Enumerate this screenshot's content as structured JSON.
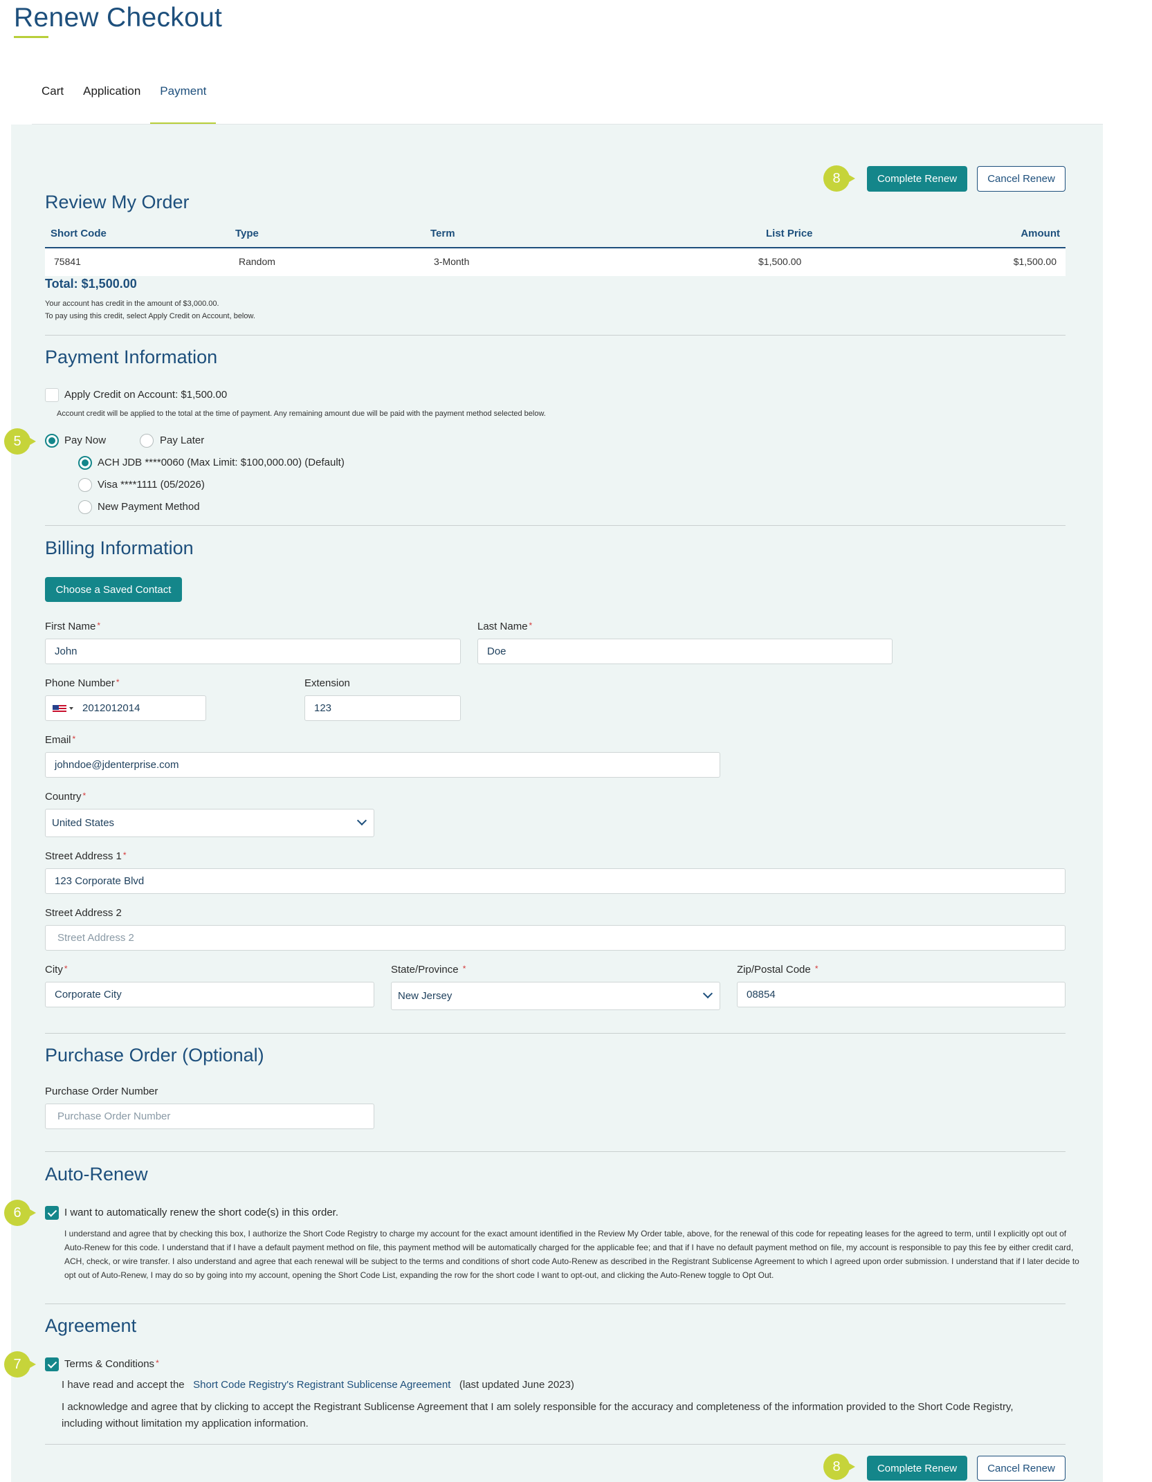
{
  "page": {
    "title": "Renew Checkout"
  },
  "tabs": [
    {
      "label": "Cart"
    },
    {
      "label": "Application"
    },
    {
      "label": "Payment"
    }
  ],
  "actions": {
    "complete_label": "Complete Renew",
    "cancel_label": "Cancel Renew"
  },
  "badges": {
    "top_complete": "8",
    "pay_now": "5",
    "auto_renew": "6",
    "terms": "7",
    "bottom_complete": "8"
  },
  "order": {
    "heading": "Review My Order",
    "columns": [
      "Short Code",
      "Type",
      "Term",
      "List Price",
      "Amount"
    ],
    "rows": [
      {
        "short_code": "75841",
        "type": "Random",
        "term": "3-Month",
        "list_price": "$1,500.00",
        "amount": "$1,500.00"
      }
    ],
    "total": "Total: $1,500.00",
    "credit_note_1": "Your account has credit in the amount of $3,000.00.",
    "credit_note_2": "To pay using this credit, select Apply Credit on Account, below."
  },
  "payment": {
    "heading": "Payment Information",
    "apply_credit_label": "Apply Credit on Account: $1,500.00",
    "apply_credit_note": "Account credit will be applied to the total at the time of payment. Any remaining amount due will be paid with the payment method selected below.",
    "pay_now": "Pay Now",
    "pay_later": "Pay Later",
    "methods": [
      {
        "label": "ACH JDB ****0060 (Max Limit: $100,000.00) (Default)"
      },
      {
        "label": "Visa ****1111 (05/2026)"
      },
      {
        "label": "New Payment Method"
      }
    ]
  },
  "billing": {
    "heading": "Billing Information",
    "saved_contact_button": "Choose a Saved Contact",
    "first_name": {
      "label": "First Name",
      "value": "John"
    },
    "last_name": {
      "label": "Last Name",
      "value": "Doe"
    },
    "phone": {
      "label": "Phone Number",
      "value": "2012012014"
    },
    "extension": {
      "label": "Extension",
      "value": "123"
    },
    "email": {
      "label": "Email",
      "value": "johndoe@jdenterprise.com"
    },
    "country": {
      "label": "Country",
      "value": "United States"
    },
    "street1": {
      "label": "Street Address 1",
      "value": "123 Corporate Blvd"
    },
    "street2": {
      "label": "Street Address 2",
      "placeholder": "Street Address 2"
    },
    "city": {
      "label": "City",
      "value": "Corporate City"
    },
    "state": {
      "label": "State/Province",
      "value": "New Jersey"
    },
    "zip": {
      "label": "Zip/Postal Code",
      "value": "08854"
    },
    "required_mark": "*"
  },
  "purchase_order": {
    "heading": "Purchase Order (Optional)",
    "label": "Purchase Order Number",
    "placeholder": "Purchase Order Number"
  },
  "auto_renew": {
    "heading": "Auto-Renew",
    "checkbox_label": "I want to automatically renew the short code(s) in this order.",
    "disclaimer": "I understand and agree that by checking this box, I authorize the Short Code Registry to charge my account for the exact amount identified in the Review My Order table, above, for the renewal of this code for repeating leases for the agreed to term, until I explicitly opt out of Auto-Renew for this code. I understand that if I have a default payment method on file, this payment method will be automatically charged for the applicable fee; and that if I have no default payment method on file, my account is responsible to pay this fee by either credit card, ACH, check, or wire transfer. I also understand and agree that each renewal will be subject to the terms and conditions of short code Auto-Renew as described in the Registrant Sublicense Agreement to which I agreed upon order submission. I understand that if I later decide to opt out of Auto-Renew, I may do so by going into my account, opening the Short Code List, expanding the row for the short code I want to opt-out, and clicking the Auto-Renew toggle to Opt Out."
  },
  "agreement": {
    "heading": "Agreement",
    "terms_label": "Terms & Conditions",
    "accept_prefix": "I have read and accept the",
    "accept_link": "Short Code Registry's Registrant Sublicense Agreement",
    "accept_suffix": "(last updated June 2023)",
    "acknowledge": "I acknowledge and agree that by clicking to accept the Registrant Sublicense Agreement that I am solely responsible for the accuracy and completeness of the information provided to the Short Code Registry, including without limitation my application information."
  }
}
